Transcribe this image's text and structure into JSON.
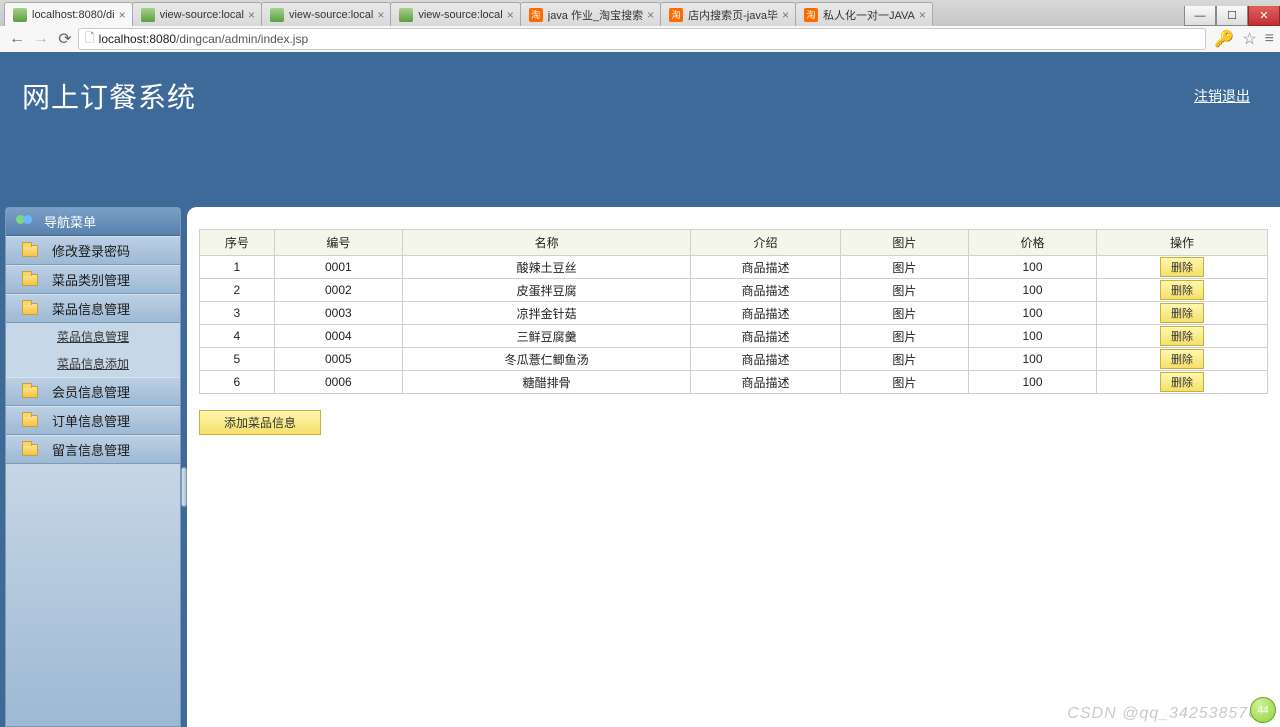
{
  "browser": {
    "tabs": [
      {
        "label": "localhost:8080/di",
        "fav": "gen",
        "active": true
      },
      {
        "label": "view-source:local",
        "fav": "gen"
      },
      {
        "label": "view-source:local",
        "fav": "gen"
      },
      {
        "label": "view-source:local",
        "fav": "gen"
      },
      {
        "label": "java 作业_淘宝搜索",
        "fav": "tao"
      },
      {
        "label": "店内搜索页-java毕",
        "fav": "tao"
      },
      {
        "label": "私人化一对一JAVA",
        "fav": "tao"
      }
    ],
    "url_host": "localhost",
    "url_port": ":8080",
    "url_path": "/dingcan/admin/index.jsp",
    "badge": "44"
  },
  "header": {
    "title": "网上订餐系统",
    "logout": "注销退出"
  },
  "sidebar": {
    "header": "导航菜单",
    "items": [
      {
        "label": "修改登录密码"
      },
      {
        "label": "菜品类别管理"
      },
      {
        "label": "菜品信息管理",
        "sub": [
          "菜品信息管理",
          "菜品信息添加"
        ]
      },
      {
        "label": "会员信息管理"
      },
      {
        "label": "订单信息管理"
      },
      {
        "label": "留言信息管理"
      }
    ]
  },
  "table": {
    "headers": [
      "序号",
      "编号",
      "名称",
      "介绍",
      "图片",
      "价格",
      "操作"
    ],
    "delete_label": "删除",
    "rows": [
      {
        "seq": "1",
        "code": "0001",
        "name": "酸辣土豆丝",
        "desc": "商品描述",
        "pic": "图片",
        "price": "100"
      },
      {
        "seq": "2",
        "code": "0002",
        "name": "皮蛋拌豆腐",
        "desc": "商品描述",
        "pic": "图片",
        "price": "100"
      },
      {
        "seq": "3",
        "code": "0003",
        "name": "凉拌金针菇",
        "desc": "商品描述",
        "pic": "图片",
        "price": "100"
      },
      {
        "seq": "4",
        "code": "0004",
        "name": "三鲜豆腐羹",
        "desc": "商品描述",
        "pic": "图片",
        "price": "100"
      },
      {
        "seq": "5",
        "code": "0005",
        "name": "冬瓜薏仁鲫鱼汤",
        "desc": "商品描述",
        "pic": "图片",
        "price": "100"
      },
      {
        "seq": "6",
        "code": "0006",
        "name": "糖醋排骨",
        "desc": "商品描述",
        "pic": "图片",
        "price": "100"
      }
    ],
    "add_label": "添加菜品信息"
  },
  "watermark": "CSDN @qq_3425385768"
}
